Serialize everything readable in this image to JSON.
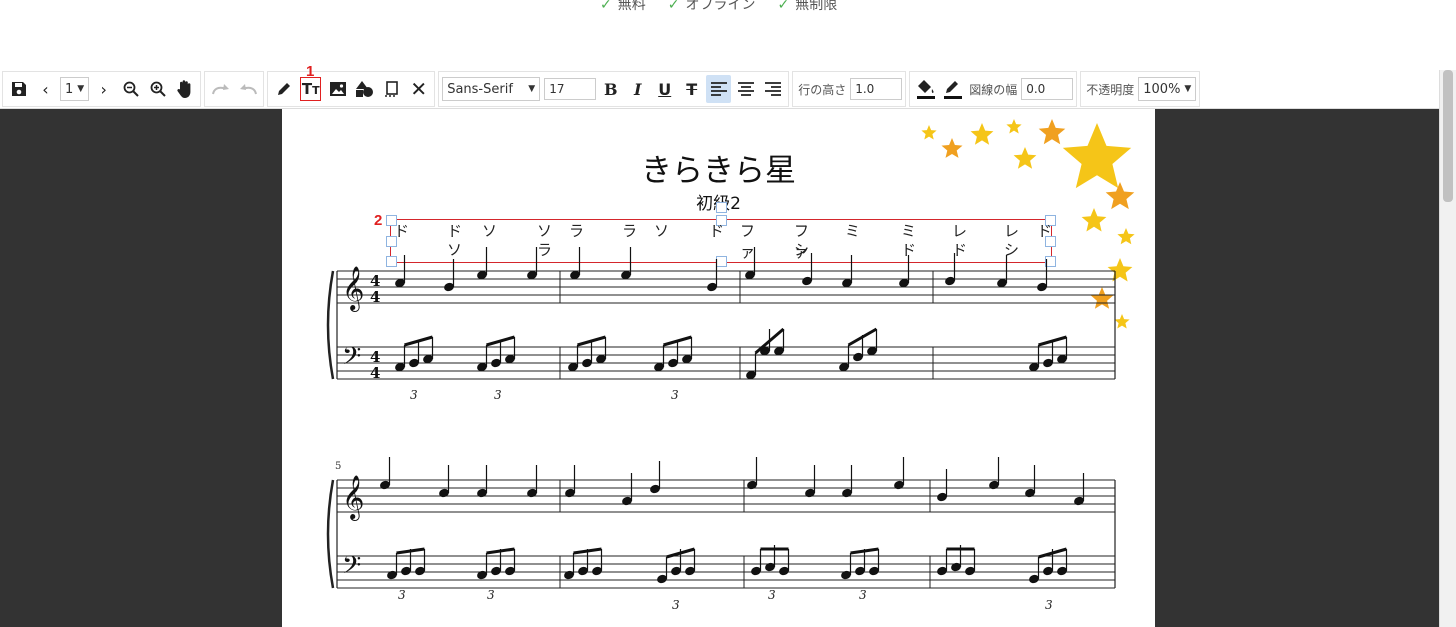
{
  "features": [
    "無料",
    "オフライン",
    "無制限"
  ],
  "toolbar": {
    "page_select": "1",
    "font_family": "Sans-Serif",
    "font_size": "17",
    "line_height_label": "行の高さ",
    "line_height_value": "1.0",
    "stroke_width_label": "図線の幅",
    "stroke_width_value": "0.0",
    "opacity_label": "不透明度",
    "opacity_value": "100%"
  },
  "markers": {
    "toolbar_step": "1",
    "annotation_step": "2"
  },
  "score": {
    "title": "きらきら星",
    "subtitle": "初級2",
    "lyrics_top": [
      "ド",
      "ド",
      "ソ",
      "ソ",
      "ラ",
      "ラ",
      "ソ",
      "ド",
      "ファ",
      "ファ",
      "ミ",
      "ミ",
      "レ",
      "レ",
      "ド"
    ],
    "lyrics_bottom": [
      "ソ",
      "ラ",
      "シ",
      "ド",
      "ド",
      "シ"
    ],
    "measure_number": "5",
    "triplet": "3"
  },
  "colors": {
    "annotation_border": "#d4262c",
    "viewer_bg": "#333333",
    "active_tool": "#cfe1f5"
  }
}
